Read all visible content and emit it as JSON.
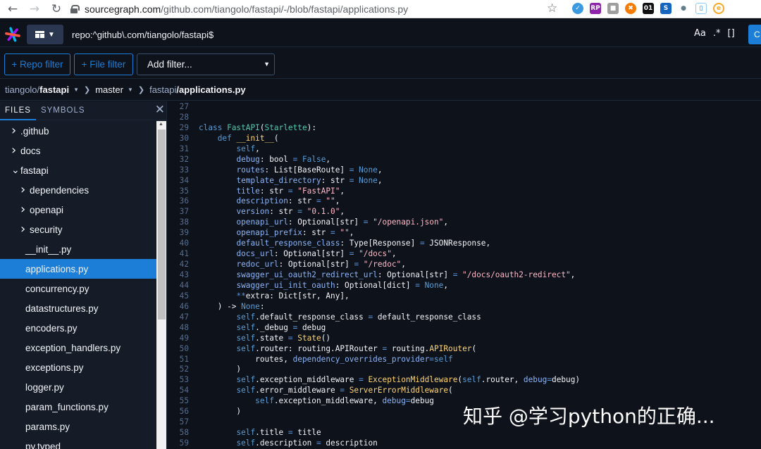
{
  "browser": {
    "back_icon": "back-arrow-icon",
    "forward_icon": "forward-arrow-icon",
    "reload_icon": "reload-icon",
    "url_host": "sourcegraph.com",
    "url_path": "/github.com/tiangolo/fastapi/-/blob/fastapi/applications.py"
  },
  "nav": {
    "query": "repo:^github\\.com/tiangolo/fastapi$",
    "case_toggle": "Aa",
    "regex_toggle": ".*",
    "structural_toggle": "[]",
    "search_label": "C"
  },
  "filters": {
    "repo_filter": "+ Repo filter",
    "file_filter": "+ File filter",
    "add_filter": "Add filter..."
  },
  "breadcrumb": {
    "owner": "tiangolo/",
    "repo": "fastapi",
    "branch": "master",
    "dir": "fastapi",
    "slash": "/",
    "file": "applications.py"
  },
  "sidebar": {
    "tabs": [
      "FILES",
      "SYMBOLS"
    ],
    "items": [
      {
        "label": ".github",
        "depth": 0,
        "expander": "closed"
      },
      {
        "label": "docs",
        "depth": 0,
        "expander": "closed"
      },
      {
        "label": "fastapi",
        "depth": 0,
        "expander": "open"
      },
      {
        "label": "dependencies",
        "depth": 1,
        "expander": "closed"
      },
      {
        "label": "openapi",
        "depth": 1,
        "expander": "closed"
      },
      {
        "label": "security",
        "depth": 1,
        "expander": "closed"
      },
      {
        "label": "__init__.py",
        "depth": 1,
        "expander": "none"
      },
      {
        "label": "applications.py",
        "depth": 1,
        "expander": "none",
        "active": true
      },
      {
        "label": "concurrency.py",
        "depth": 1,
        "expander": "none"
      },
      {
        "label": "datastructures.py",
        "depth": 1,
        "expander": "none"
      },
      {
        "label": "encoders.py",
        "depth": 1,
        "expander": "none"
      },
      {
        "label": "exception_handlers.py",
        "depth": 1,
        "expander": "none"
      },
      {
        "label": "exceptions.py",
        "depth": 1,
        "expander": "none"
      },
      {
        "label": "logger.py",
        "depth": 1,
        "expander": "none"
      },
      {
        "label": "param_functions.py",
        "depth": 1,
        "expander": "none"
      },
      {
        "label": "params.py",
        "depth": 1,
        "expander": "none"
      },
      {
        "label": "py.typed",
        "depth": 1,
        "expander": "none"
      }
    ]
  },
  "code": {
    "lines": [
      {
        "n": "27",
        "tokens": []
      },
      {
        "n": "28",
        "tokens": []
      },
      {
        "n": "29",
        "tokens": [
          [
            "kw",
            "class "
          ],
          [
            "ty",
            "FastAPI"
          ],
          [
            "",
            "("
          ],
          [
            "ty",
            "Starlette"
          ],
          [
            "",
            "):"
          ]
        ]
      },
      {
        "n": "30",
        "tokens": [
          [
            "",
            "    "
          ],
          [
            "kw",
            "def "
          ],
          [
            "fn",
            "__init__"
          ],
          [
            "",
            "("
          ]
        ]
      },
      {
        "n": "31",
        "tokens": [
          [
            "",
            "        "
          ],
          [
            "kw",
            "self"
          ],
          [
            "",
            ","
          ]
        ]
      },
      {
        "n": "32",
        "tokens": [
          [
            "",
            "        "
          ],
          [
            "pr",
            "debug"
          ],
          [
            "",
            ": bool "
          ],
          [
            "op",
            "="
          ],
          [
            "kw",
            " False"
          ],
          [
            "",
            ","
          ]
        ]
      },
      {
        "n": "33",
        "tokens": [
          [
            "",
            "        "
          ],
          [
            "pr",
            "routes"
          ],
          [
            "",
            ": List[BaseRoute] "
          ],
          [
            "op",
            "="
          ],
          [
            "kw",
            " None"
          ],
          [
            "",
            ","
          ]
        ]
      },
      {
        "n": "34",
        "tokens": [
          [
            "",
            "        "
          ],
          [
            "pr",
            "template_directory"
          ],
          [
            "",
            ": str "
          ],
          [
            "op",
            "="
          ],
          [
            "kw",
            " None"
          ],
          [
            "",
            ","
          ]
        ]
      },
      {
        "n": "35",
        "tokens": [
          [
            "",
            "        "
          ],
          [
            "pr",
            "title"
          ],
          [
            "",
            ": str "
          ],
          [
            "op",
            "="
          ],
          [
            "st",
            " \"FastAPI\""
          ],
          [
            "",
            ","
          ]
        ]
      },
      {
        "n": "36",
        "tokens": [
          [
            "",
            "        "
          ],
          [
            "pr",
            "description"
          ],
          [
            "",
            ": str "
          ],
          [
            "op",
            "="
          ],
          [
            "st",
            " \"\""
          ],
          [
            "",
            ","
          ]
        ]
      },
      {
        "n": "37",
        "tokens": [
          [
            "",
            "        "
          ],
          [
            "pr",
            "version"
          ],
          [
            "",
            ": str "
          ],
          [
            "op",
            "="
          ],
          [
            "st",
            " \"0.1.0\""
          ],
          [
            "",
            ","
          ]
        ]
      },
      {
        "n": "38",
        "tokens": [
          [
            "",
            "        "
          ],
          [
            "pr",
            "openapi_url"
          ],
          [
            "",
            ": Optional[str] "
          ],
          [
            "op",
            "="
          ],
          [
            "st",
            " \"/openapi.json\""
          ],
          [
            "",
            ","
          ]
        ]
      },
      {
        "n": "39",
        "tokens": [
          [
            "",
            "        "
          ],
          [
            "pr",
            "openapi_prefix"
          ],
          [
            "",
            ": str "
          ],
          [
            "op",
            "="
          ],
          [
            "st",
            " \"\""
          ],
          [
            "",
            ","
          ]
        ]
      },
      {
        "n": "40",
        "tokens": [
          [
            "",
            "        "
          ],
          [
            "pr",
            "default_response_class"
          ],
          [
            "",
            ": Type[Response] "
          ],
          [
            "op",
            "="
          ],
          [
            "",
            " JSONResponse,"
          ]
        ]
      },
      {
        "n": "41",
        "tokens": [
          [
            "",
            "        "
          ],
          [
            "pr",
            "docs_url"
          ],
          [
            "",
            ": Optional[str] "
          ],
          [
            "op",
            "="
          ],
          [
            "st",
            " \"/docs\""
          ],
          [
            "",
            ","
          ]
        ]
      },
      {
        "n": "42",
        "tokens": [
          [
            "",
            "        "
          ],
          [
            "pr",
            "redoc_url"
          ],
          [
            "",
            ": Optional[str] "
          ],
          [
            "op",
            "="
          ],
          [
            "st",
            " \"/redoc\""
          ],
          [
            "",
            ","
          ]
        ]
      },
      {
        "n": "43",
        "tokens": [
          [
            "",
            "        "
          ],
          [
            "pr",
            "swagger_ui_oauth2_redirect_url"
          ],
          [
            "",
            ": Optional[str] "
          ],
          [
            "op",
            "="
          ],
          [
            "st",
            " \"/docs/oauth2-redirect\""
          ],
          [
            "",
            ","
          ]
        ]
      },
      {
        "n": "44",
        "tokens": [
          [
            "",
            "        "
          ],
          [
            "pr",
            "swagger_ui_init_oauth"
          ],
          [
            "",
            ": Optional[dict] "
          ],
          [
            "op",
            "="
          ],
          [
            "kw",
            " None"
          ],
          [
            "",
            ","
          ]
        ]
      },
      {
        "n": "45",
        "tokens": [
          [
            "",
            "        "
          ],
          [
            "op",
            "**"
          ],
          [
            "",
            "extra: Dict[str, Any],"
          ]
        ]
      },
      {
        "n": "46",
        "tokens": [
          [
            "",
            "    ) -> "
          ],
          [
            "kw",
            "None"
          ],
          [
            "",
            ":"
          ]
        ]
      },
      {
        "n": "47",
        "tokens": [
          [
            "",
            "        "
          ],
          [
            "kw",
            "self"
          ],
          [
            "",
            ".default_response_class "
          ],
          [
            "op",
            "="
          ],
          [
            "",
            " default_response_class"
          ]
        ]
      },
      {
        "n": "48",
        "tokens": [
          [
            "",
            "        "
          ],
          [
            "kw",
            "self"
          ],
          [
            "",
            "._debug "
          ],
          [
            "op",
            "="
          ],
          [
            "",
            " debug"
          ]
        ]
      },
      {
        "n": "49",
        "tokens": [
          [
            "",
            "        "
          ],
          [
            "kw",
            "self"
          ],
          [
            "",
            ".state "
          ],
          [
            "op",
            "="
          ],
          [
            "fn",
            " State"
          ],
          [
            "",
            "()"
          ]
        ]
      },
      {
        "n": "50",
        "tokens": [
          [
            "",
            "        "
          ],
          [
            "kw",
            "self"
          ],
          [
            "",
            ".router: routing.APIRouter "
          ],
          [
            "op",
            "="
          ],
          [
            "",
            " routing."
          ],
          [
            "fn",
            "APIRouter"
          ],
          [
            "",
            "("
          ]
        ]
      },
      {
        "n": "51",
        "tokens": [
          [
            "",
            "            routes, "
          ],
          [
            "pr",
            "dependency_overrides_provider"
          ],
          [
            "op",
            "="
          ],
          [
            "kw",
            "self"
          ]
        ]
      },
      {
        "n": "52",
        "tokens": [
          [
            "",
            "        )"
          ]
        ]
      },
      {
        "n": "53",
        "tokens": [
          [
            "",
            "        "
          ],
          [
            "kw",
            "self"
          ],
          [
            "",
            ".exception_middleware "
          ],
          [
            "op",
            "="
          ],
          [
            "fn",
            " ExceptionMiddleware"
          ],
          [
            "",
            "("
          ],
          [
            "kw",
            "self"
          ],
          [
            "",
            ".router, "
          ],
          [
            "pr",
            "debug"
          ],
          [
            "op",
            "="
          ],
          [
            "",
            "debug)"
          ]
        ]
      },
      {
        "n": "54",
        "tokens": [
          [
            "",
            "        "
          ],
          [
            "kw",
            "self"
          ],
          [
            "",
            ".error_middleware "
          ],
          [
            "op",
            "="
          ],
          [
            "fn",
            " ServerErrorMiddleware"
          ],
          [
            "",
            "("
          ]
        ]
      },
      {
        "n": "55",
        "tokens": [
          [
            "",
            "            "
          ],
          [
            "kw",
            "self"
          ],
          [
            "",
            ".exception_middleware, "
          ],
          [
            "pr",
            "debug"
          ],
          [
            "op",
            "="
          ],
          [
            "",
            "debug"
          ]
        ]
      },
      {
        "n": "56",
        "tokens": [
          [
            "",
            "        )"
          ]
        ]
      },
      {
        "n": "57",
        "tokens": []
      },
      {
        "n": "58",
        "tokens": [
          [
            "",
            "        "
          ],
          [
            "kw",
            "self"
          ],
          [
            "",
            ".title "
          ],
          [
            "op",
            "="
          ],
          [
            "",
            " title"
          ]
        ]
      },
      {
        "n": "59",
        "tokens": [
          [
            "",
            "        "
          ],
          [
            "kw",
            "self"
          ],
          [
            "",
            ".description "
          ],
          [
            "op",
            "="
          ],
          [
            "",
            " description"
          ]
        ]
      }
    ]
  },
  "watermark": "知乎 @学习python的正确..."
}
